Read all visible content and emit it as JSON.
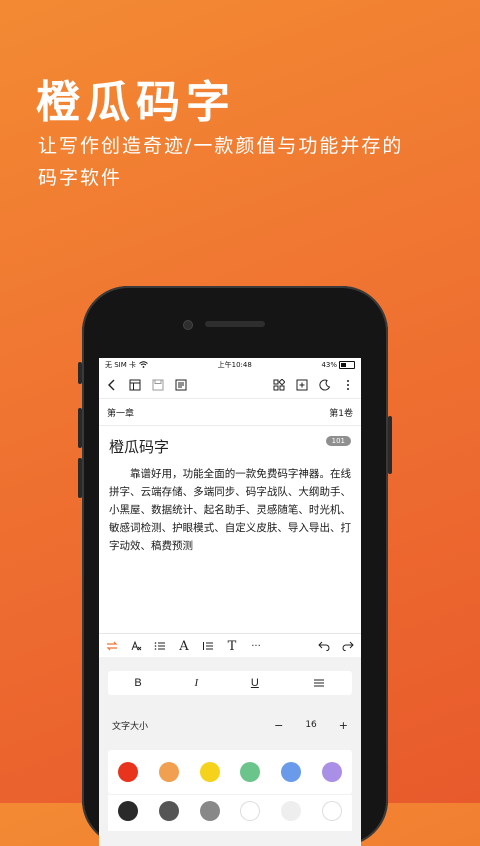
{
  "promo": {
    "headline": "橙瓜码字",
    "tagline": "让写作创造奇迹/一款颜值与功能并存的码字软件"
  },
  "status_bar": {
    "carrier": "无 SIM 卡",
    "time": "上午10:48",
    "battery": "43%",
    "battery_level": 0.43
  },
  "toolbar": {
    "left_icons": [
      "back-icon",
      "layout-icon",
      "save-icon",
      "notes-icon"
    ],
    "right_icons": [
      "grid-icon",
      "add-box-icon",
      "night-mode-icon",
      "more-vertical-icon"
    ]
  },
  "chapter": {
    "name": "第一章",
    "volume": "第1卷"
  },
  "document": {
    "title": "橙瓜码字",
    "word_count": "101",
    "body": "靠谱好用，功能全面的一款免费码字神器。在线拼字、云端存储、多端同步、码字战队、大纲助手、小黑屋、数据统计、起名助手、灵感随笔、时光机、敏感词检测、护眼模式、自定义皮肤、导入导出、打字动效、稿费预测"
  },
  "format_bar": {
    "font_label": "A",
    "title_label": "T",
    "more_label": "···"
  },
  "text_style": {
    "bold": "B",
    "italic": "I",
    "underline": "U"
  },
  "font_size": {
    "label": "文字大小",
    "minus": "−",
    "value": "16",
    "plus": "+"
  },
  "colors": {
    "row1": [
      "#e8341c",
      "#f0a050",
      "#f5d21c",
      "#6bc48a",
      "#6a9bea",
      "#a98fe6"
    ],
    "row2": [
      "#2a2a2a",
      "#555555",
      "#888888",
      "#ffffff",
      "#eeeeee",
      "#ffffff"
    ]
  },
  "theme": {
    "accent": "#ef7331"
  }
}
